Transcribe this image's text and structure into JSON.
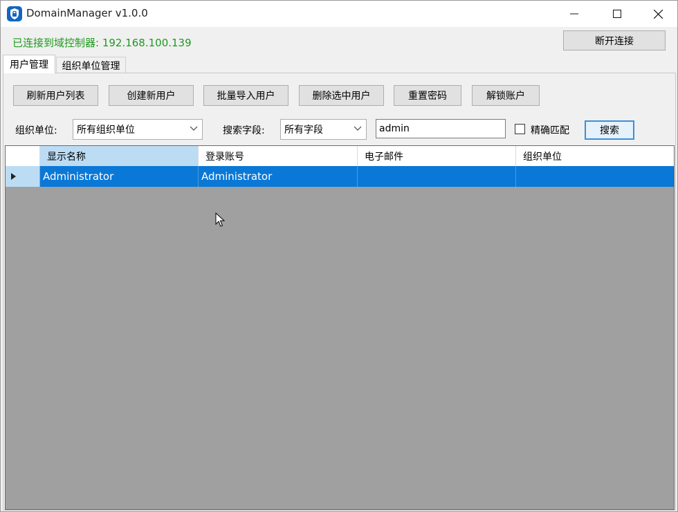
{
  "window": {
    "title": "DomainManager v1.0.0",
    "accent": "#1565c0"
  },
  "connection": {
    "status": "已连接到域控制器: 192.168.100.139",
    "status_color": "#1e9a1e",
    "disconnect_label": "断开连接"
  },
  "tabs": [
    {
      "label": "用户管理",
      "active": true
    },
    {
      "label": "组织单位管理",
      "active": false
    }
  ],
  "toolbar": {
    "refresh_label": "刷新用户列表",
    "create_label": "创建新用户",
    "import_label": "批量导入用户",
    "delete_label": "删除选中用户",
    "reset_label": "重置密码",
    "unlock_label": "解锁账户"
  },
  "filters": {
    "ou_label": "组织单位:",
    "ou_value": "所有组织单位",
    "field_label": "搜索字段:",
    "field_value": "所有字段",
    "search_value": "admin",
    "exact_label": "精确匹配",
    "exact_checked": false,
    "search_button": "搜索"
  },
  "grid": {
    "columns": [
      "显示名称",
      "登录账号",
      "电子邮件",
      "组织单位"
    ],
    "rows": [
      {
        "display_name": "Administrator",
        "login": "Administrator",
        "email": "",
        "ou": ""
      }
    ],
    "selection_color": "#0a78d7"
  }
}
